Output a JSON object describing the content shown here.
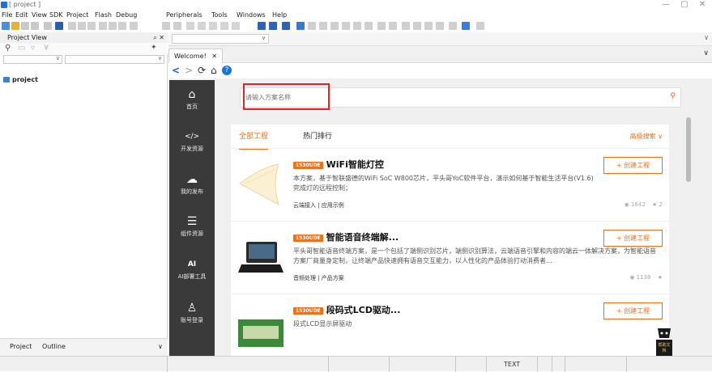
{
  "window": {
    "title": "[ project ]"
  },
  "menubar": {
    "items": [
      "File",
      "Edit",
      "View",
      "SDK",
      "Project",
      "Flash",
      "Debug",
      "Peripherals",
      "Tools",
      "Windows",
      "Help"
    ]
  },
  "left_panel": {
    "title": "Project View",
    "tree_root": "project",
    "bottom_tabs": [
      "Project",
      "Outline"
    ]
  },
  "tabs": [
    {
      "label": "Welcome!",
      "close": "✕"
    }
  ],
  "nav": {
    "back": "<",
    "forward": ">",
    "refresh": "⟳",
    "home": "⌂",
    "help": "?"
  },
  "sidebar_nav": [
    {
      "label": "首页",
      "icon": "home-icon",
      "glyph": "⌂"
    },
    {
      "label": "开发资源",
      "icon": "code-icon",
      "glyph": "</>"
    },
    {
      "label": "我的发布",
      "icon": "cloud-icon",
      "glyph": "☁"
    },
    {
      "label": "组件资源",
      "icon": "component-icon",
      "glyph": "☰"
    },
    {
      "label": "AI部署工具",
      "icon": "ai-icon",
      "glyph": "AI"
    },
    {
      "label": "账号登录",
      "icon": "user-icon",
      "glyph": "♙"
    }
  ],
  "search": {
    "placeholder": "请输入方案名称"
  },
  "filter": {
    "tabs": [
      "全部工程",
      "热门排行"
    ],
    "advanced": "高级搜索 ∨"
  },
  "cards": [
    {
      "badge": "1530UDE",
      "title": "WiFi智能灯控",
      "desc": "本方案，基于智联盛德的WiFi SoC W800芯片，平头哥YoC软件平台，演示如何基于智能生活平台(V1.6)完成灯的远程控制；",
      "tags": "云端接入 | 应用示例",
      "views": "1642",
      "stars": "2",
      "button": "+ 创建工程"
    },
    {
      "badge": "1530UDE",
      "title": "智能语音终端解...",
      "desc": "平头哥智能语音终端方案，是一个包括了端侧识别芯片，端侧识别算法，云端语音引擎和内容的端云一体解决方案，为智能语音方案厂商量身定制，让终端产品快速拥有语音交互能力，以人性化的产品体验打动消费者...",
      "tags": "音频处理 | 产品方案",
      "views": "1138",
      "stars": "",
      "button": "+ 创建工程"
    },
    {
      "badge": "1530UDE",
      "title": "段码式LCD驱动...",
      "desc": "段式LCD显示屏驱动",
      "tags": "",
      "views": "",
      "stars": "",
      "button": "+ 创建工程"
    }
  ],
  "float_widget": {
    "label": "帮助文档"
  },
  "statusbar": {
    "mode": "TEXT"
  },
  "colors": {
    "accent": "#e8731e",
    "sidebar": "#3a3a3a",
    "highlight": "#e0242a"
  }
}
